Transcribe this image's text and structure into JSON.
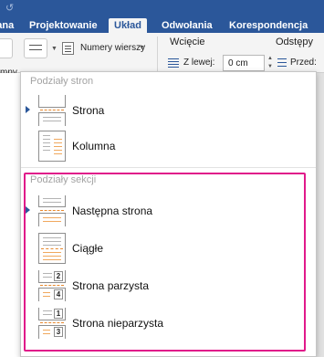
{
  "ribbon": {
    "quick_access_icon": "undo-icon",
    "tabs": [
      {
        "label": "rana",
        "active": false
      },
      {
        "label": "Projektowanie",
        "active": false
      },
      {
        "label": "Układ",
        "active": true
      },
      {
        "label": "Odwołania",
        "active": false
      },
      {
        "label": "Korespondencja",
        "active": false
      }
    ],
    "breaks_button_icon": "page-breaks-icon",
    "line_numbers_label": "Numery wierszy",
    "cut_label": "mny",
    "indent": {
      "group_title": "Wcięcie",
      "left_label": "Z lewej:",
      "left_value": "0 cm"
    },
    "spacing": {
      "group_title": "Odstępy",
      "before_label": "Przed:"
    },
    "accent_color": "#2b579a"
  },
  "menu": {
    "page_breaks_header": "Podziały stron",
    "page_break_items": [
      {
        "label": "Strona",
        "icon": "page-break-icon",
        "selected": true
      },
      {
        "label": "Kolumna",
        "icon": "column-break-icon",
        "selected": false
      }
    ],
    "section_breaks_header": "Podziały sekcji",
    "section_break_items": [
      {
        "label": "Następna strona",
        "icon": "next-page-section-break-icon",
        "selected": true
      },
      {
        "label": "Ciągłe",
        "icon": "continuous-section-break-icon",
        "selected": false
      },
      {
        "label": "Strona parzysta",
        "icon": "even-page-section-break-icon",
        "selected": false,
        "tags": [
          "2",
          "4"
        ]
      },
      {
        "label": "Strona nieparzysta",
        "icon": "odd-page-section-break-icon",
        "selected": false,
        "tags": [
          "1",
          "3"
        ]
      }
    ],
    "highlight_color": "#e0198a"
  }
}
